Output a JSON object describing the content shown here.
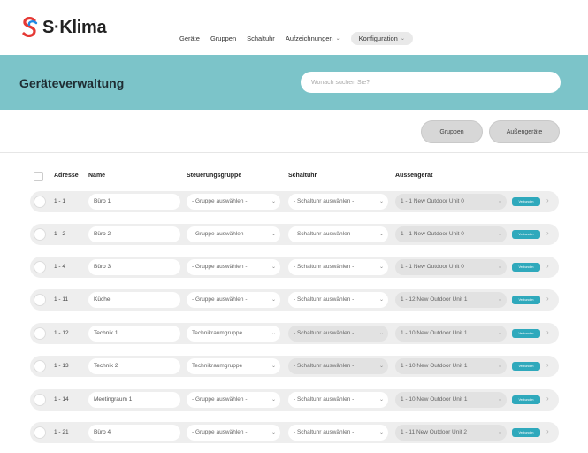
{
  "app": {
    "logo_text": "S·Klima",
    "brand_colors": {
      "red": "#e53935",
      "blue": "#1e88e5",
      "teal": "#7cc4c9",
      "badge": "#2fa9bc"
    }
  },
  "nav": {
    "items": [
      {
        "label": "Geräte",
        "dropdown": false
      },
      {
        "label": "Gruppen",
        "dropdown": false
      },
      {
        "label": "Schaltuhr",
        "dropdown": false
      },
      {
        "label": "Aufzeichnungen",
        "dropdown": true
      },
      {
        "label": "Konfiguration",
        "dropdown": true,
        "active": true
      }
    ]
  },
  "page": {
    "title": "Geräteverwaltung",
    "search_placeholder": "Wonach suchen Sie?"
  },
  "actions": {
    "gruppen": "Gruppen",
    "aussengeraete": "Außengeräte"
  },
  "table": {
    "headers": {
      "adresse": "Adresse",
      "name": "Name",
      "gruppe": "Steuerungsgruppe",
      "schaltuhr": "Schaltuhr",
      "aussengeraet": "Aussengerät"
    },
    "rows": [
      {
        "address": "1 - 1",
        "name": "Büro 1",
        "gruppe": "- Gruppe auswählen -",
        "schaltuhr": "- Schaltuhr auswählen -",
        "aussengeraet": "1 - 1 New Outdoor Unit 0",
        "badge": "Verbunden"
      },
      {
        "address": "1 - 2",
        "name": "Büro 2",
        "gruppe": "- Gruppe auswählen -",
        "schaltuhr": "- Schaltuhr auswählen -",
        "aussengeraet": "1 - 1 New Outdoor Unit 0",
        "badge": "Verbunden"
      },
      {
        "address": "1 - 4",
        "name": "Büro 3",
        "gruppe": "- Gruppe auswählen -",
        "schaltuhr": "- Schaltuhr auswählen -",
        "aussengeraet": "1 - 1 New Outdoor Unit 0",
        "badge": "Verbunden"
      },
      {
        "address": "1 - 11",
        "name": "Küche",
        "gruppe": "- Gruppe auswählen -",
        "schaltuhr": "- Schaltuhr auswählen -",
        "aussengeraet": "1 - 12 New Outdoor Unit 1",
        "badge": "Verbunden"
      },
      {
        "address": "1 - 12",
        "name": "Technik 1",
        "gruppe": "Technikraumgruppe",
        "schaltuhr": "- Schaltuhr auswählen -",
        "aussengeraet": "1 - 10 New Outdoor Unit 1",
        "badge": "Verbunden",
        "uhr_grey": true
      },
      {
        "address": "1 - 13",
        "name": "Technik 2",
        "gruppe": "Technikraumgruppe",
        "schaltuhr": "- Schaltuhr auswählen -",
        "aussengeraet": "1 - 10 New Outdoor Unit 1",
        "badge": "Verbunden",
        "uhr_grey": true
      },
      {
        "address": "1 - 14",
        "name": "Meetingraum 1",
        "gruppe": "- Gruppe auswählen -",
        "schaltuhr": "- Schaltuhr auswählen -",
        "aussengeraet": "1 - 10 New Outdoor Unit 1",
        "badge": "Verbunden"
      },
      {
        "address": "1 - 21",
        "name": "Büro 4",
        "gruppe": "- Gruppe auswählen -",
        "schaltuhr": "- Schaltuhr auswählen -",
        "aussengeraet": "1 - 11 New Outdoor Unit 2",
        "badge": "Verbunden"
      }
    ]
  }
}
